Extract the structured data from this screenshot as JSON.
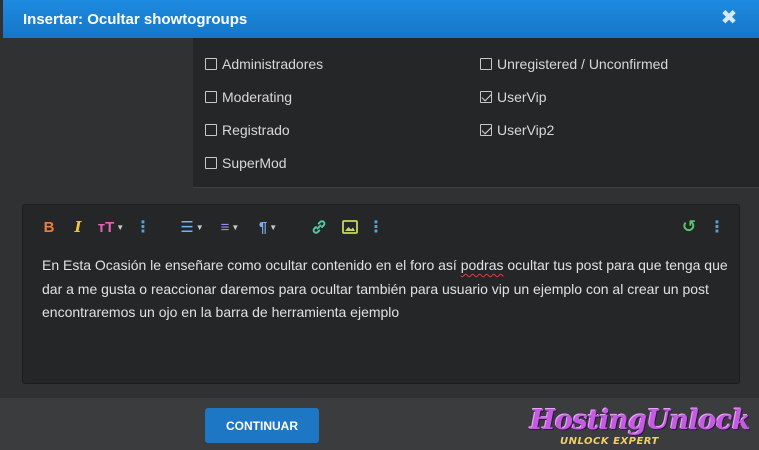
{
  "dialog": {
    "title": "Insertar: Ocultar showtogroups",
    "close_glyph": "✖"
  },
  "groups": [
    {
      "label": "Administradores",
      "checked": false
    },
    {
      "label": "Moderating",
      "checked": false
    },
    {
      "label": "Registrado",
      "checked": false
    },
    {
      "label": "SuperMod",
      "checked": false
    },
    {
      "label": "Unregistered / Unconfirmed",
      "checked": false
    },
    {
      "label": "UserVip",
      "checked": true
    },
    {
      "label": "UserVip2",
      "checked": true
    }
  ],
  "toolbar": {
    "bold": "B",
    "italic": "I",
    "font_size": "тT",
    "more": "⋮",
    "list": "☰",
    "align": "≡",
    "paragraph": "¶",
    "link": "🔗",
    "image": "▣",
    "undo": "↺"
  },
  "editor": {
    "text_before": "En Esta Ocasión le enseñare como ocultar contenido en el foro así ",
    "misspelled": "podras",
    "text_after": " ocultar tus post para que tenga que dar a me gusta o reaccionar daremos para ocultar  también para usuario vip un ejemplo con al crear un post encontraremos un ojo en la barra de herramienta ejemplo"
  },
  "footer": {
    "continue_label": "CONTINUAR"
  },
  "watermark": {
    "brand": "HostingUnlock",
    "sub_a": "UNLOCK",
    "sub_b": "EXPERT"
  },
  "colors": {
    "titlebar": "#1d8be0",
    "button": "#1d77c4",
    "bold_icon": "#f07c3c",
    "italic_icon": "#f2c23a",
    "fontsize_icon": "#e560b8",
    "list_icon": "#6fb3f0",
    "align_icon": "#9b8de8",
    "paragraph_icon": "#7aaee8",
    "link_icon": "#55c89c",
    "image_icon": "#c8d95a",
    "undo_icon": "#58c26c"
  }
}
